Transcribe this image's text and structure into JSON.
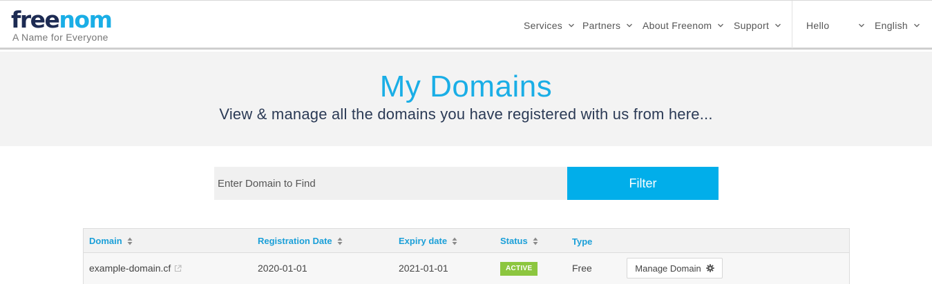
{
  "header": {
    "logo": {
      "part1": "free",
      "part2": "nom",
      "tagline": "A Name for Everyone"
    },
    "nav": [
      {
        "label": "Services"
      },
      {
        "label": "Partners"
      },
      {
        "label": "About Freenom"
      },
      {
        "label": "Support"
      }
    ],
    "user": {
      "greeting": "Hello"
    },
    "language": {
      "label": "English"
    }
  },
  "hero": {
    "title": "My Domains",
    "subtitle": "View & manage all the domains you have registered with us from here..."
  },
  "search": {
    "placeholder": "Enter Domain to Find",
    "value": "",
    "button_label": "Filter"
  },
  "table": {
    "columns": [
      "Domain",
      "Registration Date",
      "Expiry date",
      "Status",
      "Type"
    ],
    "rows": [
      {
        "domain": "example-domain.cf",
        "registration_date": "2020-01-01",
        "expiry_date": "2021-01-01",
        "status": "ACTIVE",
        "type": "Free",
        "action_label": "Manage Domain"
      }
    ]
  },
  "colors": {
    "accent": "#01aeea",
    "brand_dark": "#1d2b53",
    "status_active": "#8cc63f",
    "hero_bg": "#f3f3f3"
  },
  "icons": {
    "nav_dropdown": "chevron-down-icon",
    "sort": "sort-icon",
    "external_link": "external-link-icon",
    "settings": "gear-icon"
  }
}
